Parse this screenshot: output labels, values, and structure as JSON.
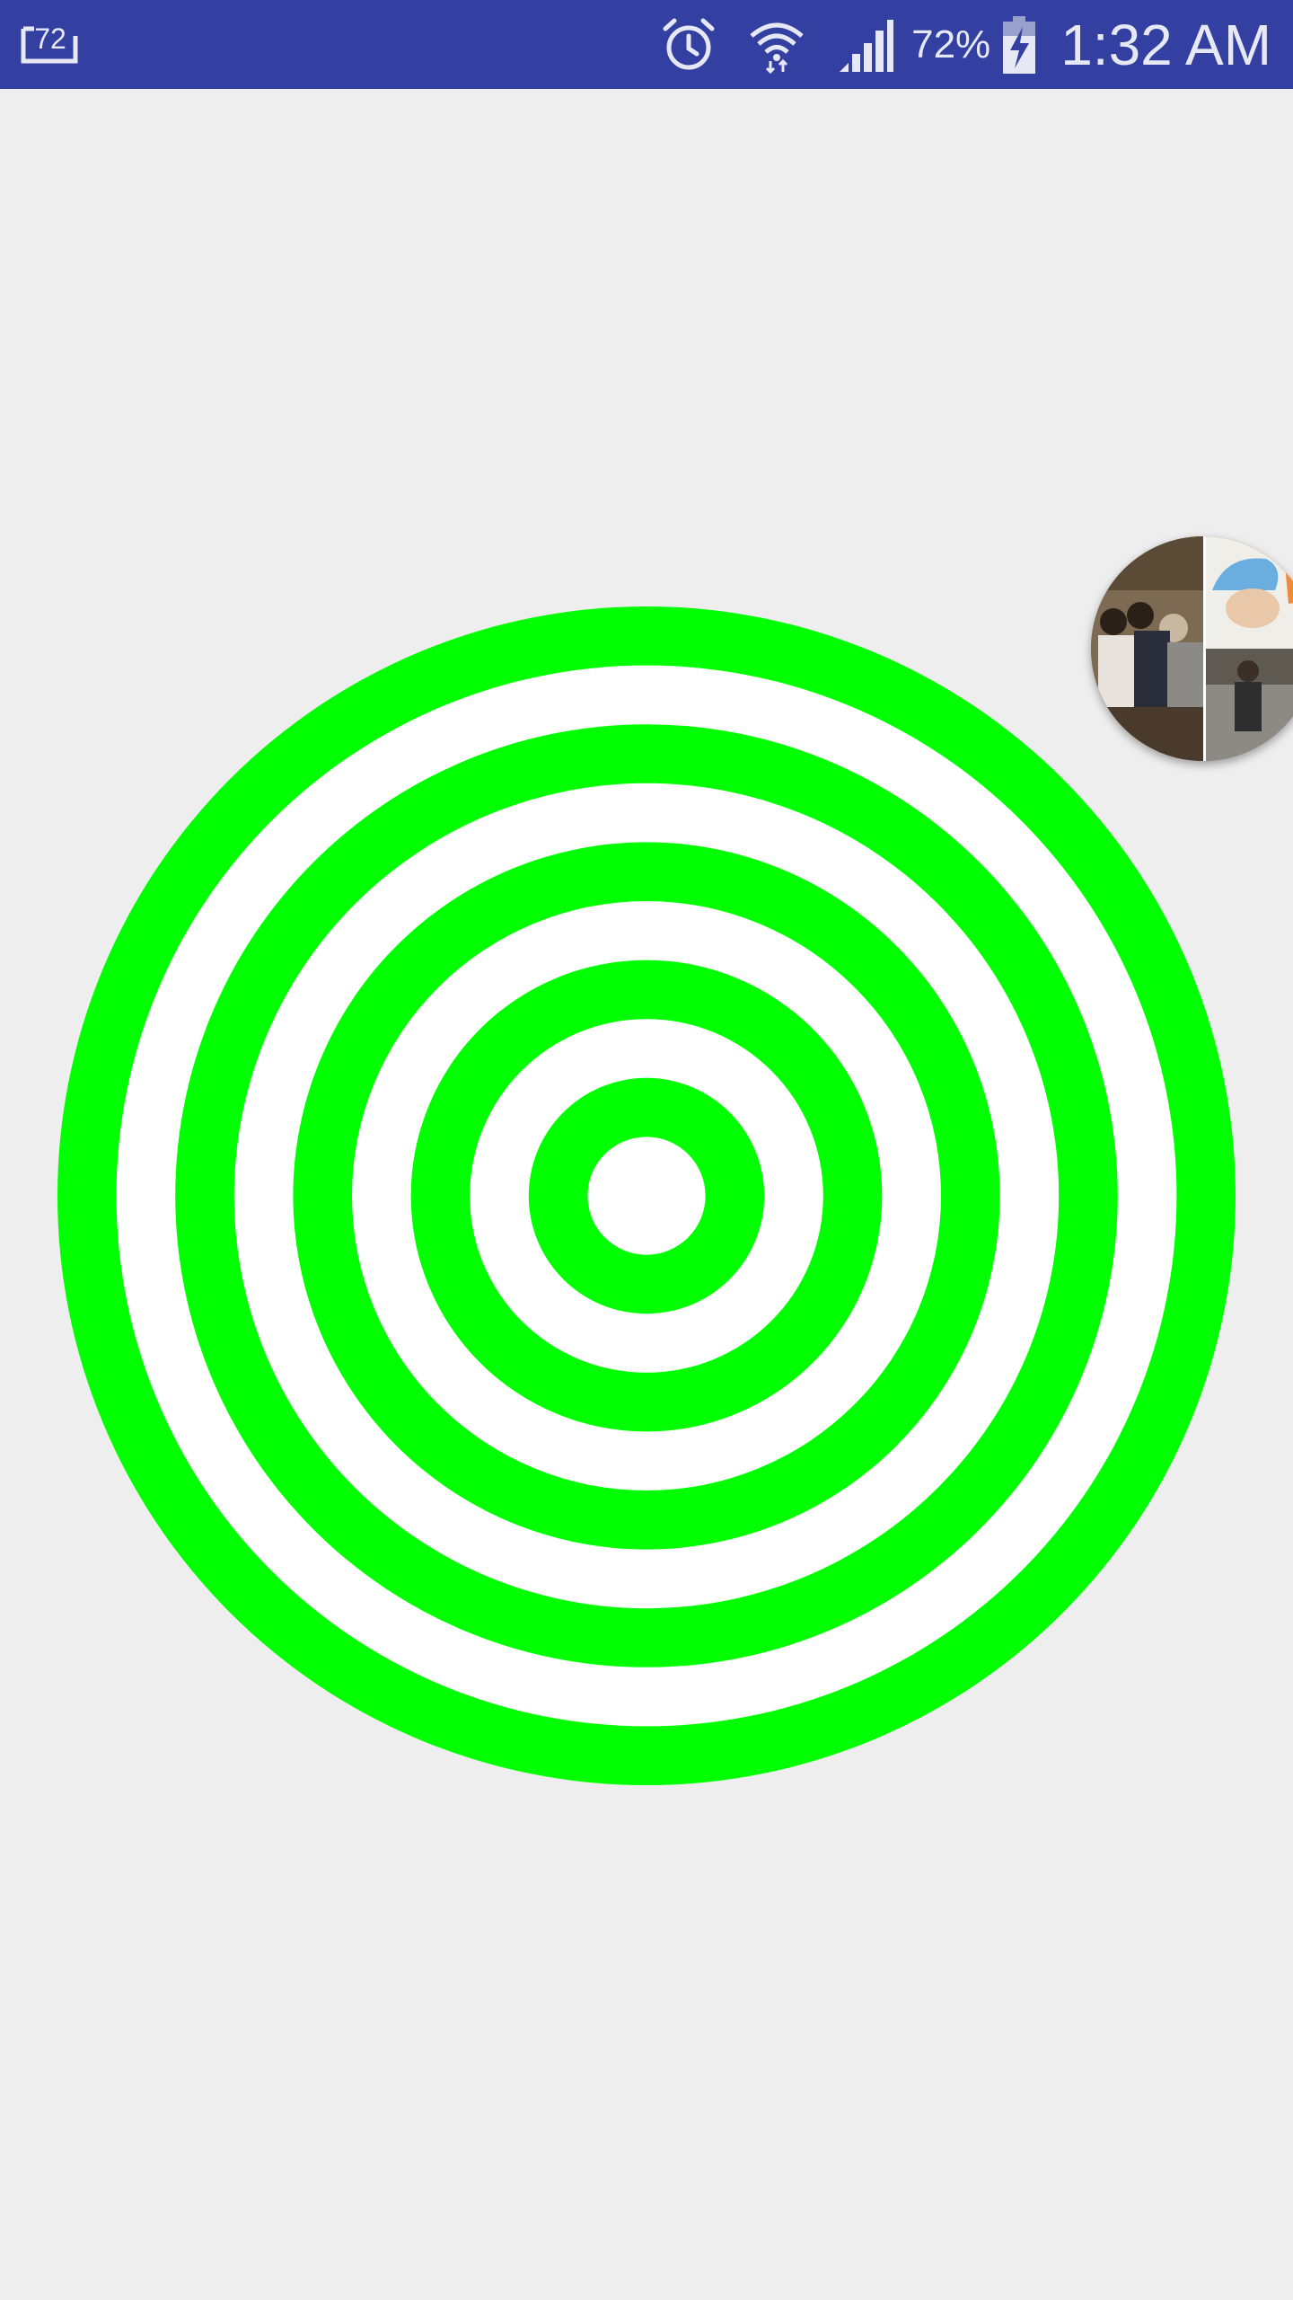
{
  "status_bar": {
    "notification_badge": "72",
    "battery_percent": "72%",
    "time": "1:32 AM",
    "icons": [
      "notification-count-icon",
      "alarm-icon",
      "wifi-icon",
      "cell-signal-icon",
      "battery-charging-icon"
    ],
    "background_color": "#3340a1"
  },
  "target": {
    "ring_colors": [
      "#00ff00",
      "#ffffff"
    ],
    "ring_count": 10,
    "background_color": "#eeeeee"
  },
  "chat_head": {
    "icon": "chat-head-avatar-icon"
  }
}
